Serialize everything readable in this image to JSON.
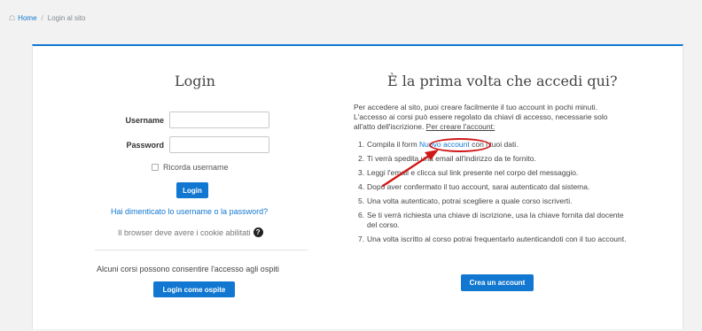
{
  "breadcrumb": {
    "home": "Home",
    "separator": "/",
    "current": "Login al sito"
  },
  "login": {
    "title": "Login",
    "username_label": "Username",
    "username_value": "",
    "password_label": "Password",
    "password_value": "",
    "remember_label": "Ricorda username",
    "login_button": "Login",
    "forgot_link": "Hai dimenticato lo username o la password?",
    "cookie_note": "Il browser deve avere i cookie abilitati",
    "guest_text": "Alcuni corsi possono consentire l'accesso agli ospiti",
    "guest_button": "Login come ospite"
  },
  "signup": {
    "title": "È la prima volta che accedi qui?",
    "intro_line1": "Per accedere al sito, puoi creare facilmente il tuo account in pochi minuti.",
    "intro_line2": "L'accesso ai corsi può essere regolato da chiavi di accesso, necessarie solo",
    "intro_line3_a": "all'atto dell'iscrizione. ",
    "intro_line3_b": "Per creare l'account:",
    "steps": [
      {
        "num": "1.",
        "pre": "Compila il form ",
        "link": "Nuovo account",
        "post": " con i tuoi dati."
      },
      {
        "num": "2.",
        "text": "Ti verrà spedita una email all'indirizzo da te fornito."
      },
      {
        "num": "3.",
        "text": "Leggi l'email e clicca sul link presente nel corpo del messaggio."
      },
      {
        "num": "4.",
        "text": "Dopo aver confermato il tuo account, sarai autenticato dal sistema."
      },
      {
        "num": "5.",
        "text": "Una volta autenticato, potrai scegliere a quale corso iscriverti."
      },
      {
        "num": "6.",
        "text": "Se ti verrà richiesta una chiave di iscrizione, usa la chiave fornita dal docente del corso."
      },
      {
        "num": "7.",
        "text": "Una volta iscritto al corso potrai frequentarlo autenticandoti con il tuo account."
      }
    ],
    "create_button": "Crea un account"
  },
  "colors": {
    "accent": "#1177d1",
    "annotation": "#d01818"
  }
}
